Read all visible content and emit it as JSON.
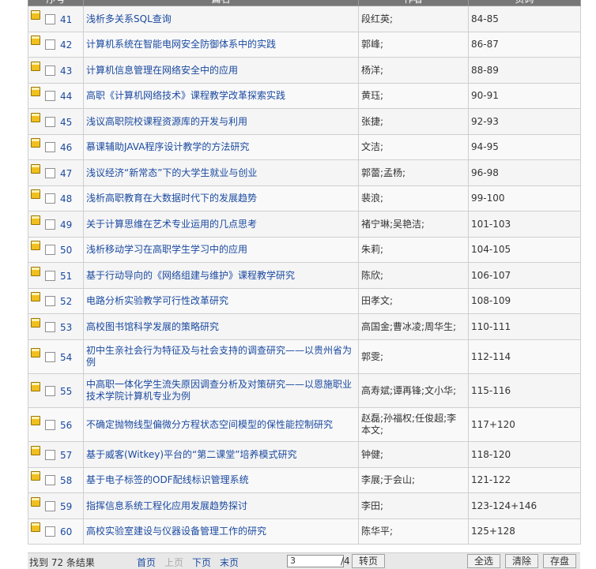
{
  "table": {
    "headers": [
      "序号",
      "篇名",
      "作者",
      "页码"
    ],
    "rows": [
      {
        "no": "41",
        "title": "浅析多关系SQL查询",
        "author": "段红英;",
        "pages": "84-85"
      },
      {
        "no": "42",
        "title": "计算机系统在智能电网安全防御体系中的实践",
        "author": "郭峰;",
        "pages": "86-87"
      },
      {
        "no": "43",
        "title": "计算机信息管理在网络安全中的应用",
        "author": "杨洋;",
        "pages": "88-89"
      },
      {
        "no": "44",
        "title": "高职《计算机网络技术》课程教学改革探索实践",
        "author": "黄珏;",
        "pages": "90-91"
      },
      {
        "no": "45",
        "title": "浅议高职院校课程资源库的开发与利用",
        "author": "张捷;",
        "pages": "92-93"
      },
      {
        "no": "46",
        "title": "慕课辅助JAVA程序设计教学的方法研究",
        "author": "文洁;",
        "pages": "94-95"
      },
      {
        "no": "47",
        "title": "浅议经济“新常态”下的大学生就业与创业",
        "author": "郭蕾;孟杨;",
        "pages": "96-98"
      },
      {
        "no": "48",
        "title": "浅析高职教育在大数据时代下的发展趋势",
        "author": "裴浪;",
        "pages": "99-100"
      },
      {
        "no": "49",
        "title": "关于计算思维在艺术专业运用的几点思考",
        "author": "褚宁琳;吴艳洁;",
        "pages": "101-103"
      },
      {
        "no": "50",
        "title": "浅析移动学习在高职学生学习中的应用",
        "author": "朱莉;",
        "pages": "104-105"
      },
      {
        "no": "51",
        "title": "基于行动导向的《网络组建与维护》课程教学研究",
        "author": "陈欣;",
        "pages": "106-107"
      },
      {
        "no": "52",
        "title": "电路分析实验教学可行性改革研究",
        "author": "田孝文;",
        "pages": "108-109"
      },
      {
        "no": "53",
        "title": "高校图书馆科学发展的策略研究",
        "author": "高国金;曹冰凌;周华生;",
        "pages": "110-111"
      },
      {
        "no": "54",
        "title": "初中生亲社会行为特征及与社会支持的调查研究——以贵州省为例",
        "author": "郭雯;",
        "pages": "112-114"
      },
      {
        "no": "55",
        "title": "中高职一体化学生流失原因调查分析及对策研究——以恩施职业技术学院计算机专业为例",
        "author": "高寿斌;谭再锋;文小华;",
        "pages": "115-116"
      },
      {
        "no": "56",
        "title": "不确定抛物线型偏微分方程状态空间模型的保性能控制研究",
        "author": "赵磊;孙福权;任俊超;李本文;",
        "pages": "117+120"
      },
      {
        "no": "57",
        "title": "基于威客(Witkey)平台的“第二课堂”培养模式研究",
        "author": "钟健;",
        "pages": "118-120"
      },
      {
        "no": "58",
        "title": "基于电子标签的ODF配线标识管理系统",
        "author": "李展;于会山;",
        "pages": "121-122"
      },
      {
        "no": "59",
        "title": "指挥信息系统工程化应用发展趋势探讨",
        "author": "李田;",
        "pages": "123-124+146"
      },
      {
        "no": "60",
        "title": "高校实验室建设与仪器设备管理工作的研究",
        "author": "陈华平;",
        "pages": "125+128"
      }
    ]
  },
  "pager": {
    "result_text": "找到 72 条结果",
    "first": "首页",
    "prev": "上页",
    "next": "下页",
    "last": "末页",
    "page_value": "3",
    "page_suffix": "/4",
    "go": "转页",
    "select_all": "全选",
    "clear": "清除",
    "save": "存盘"
  }
}
